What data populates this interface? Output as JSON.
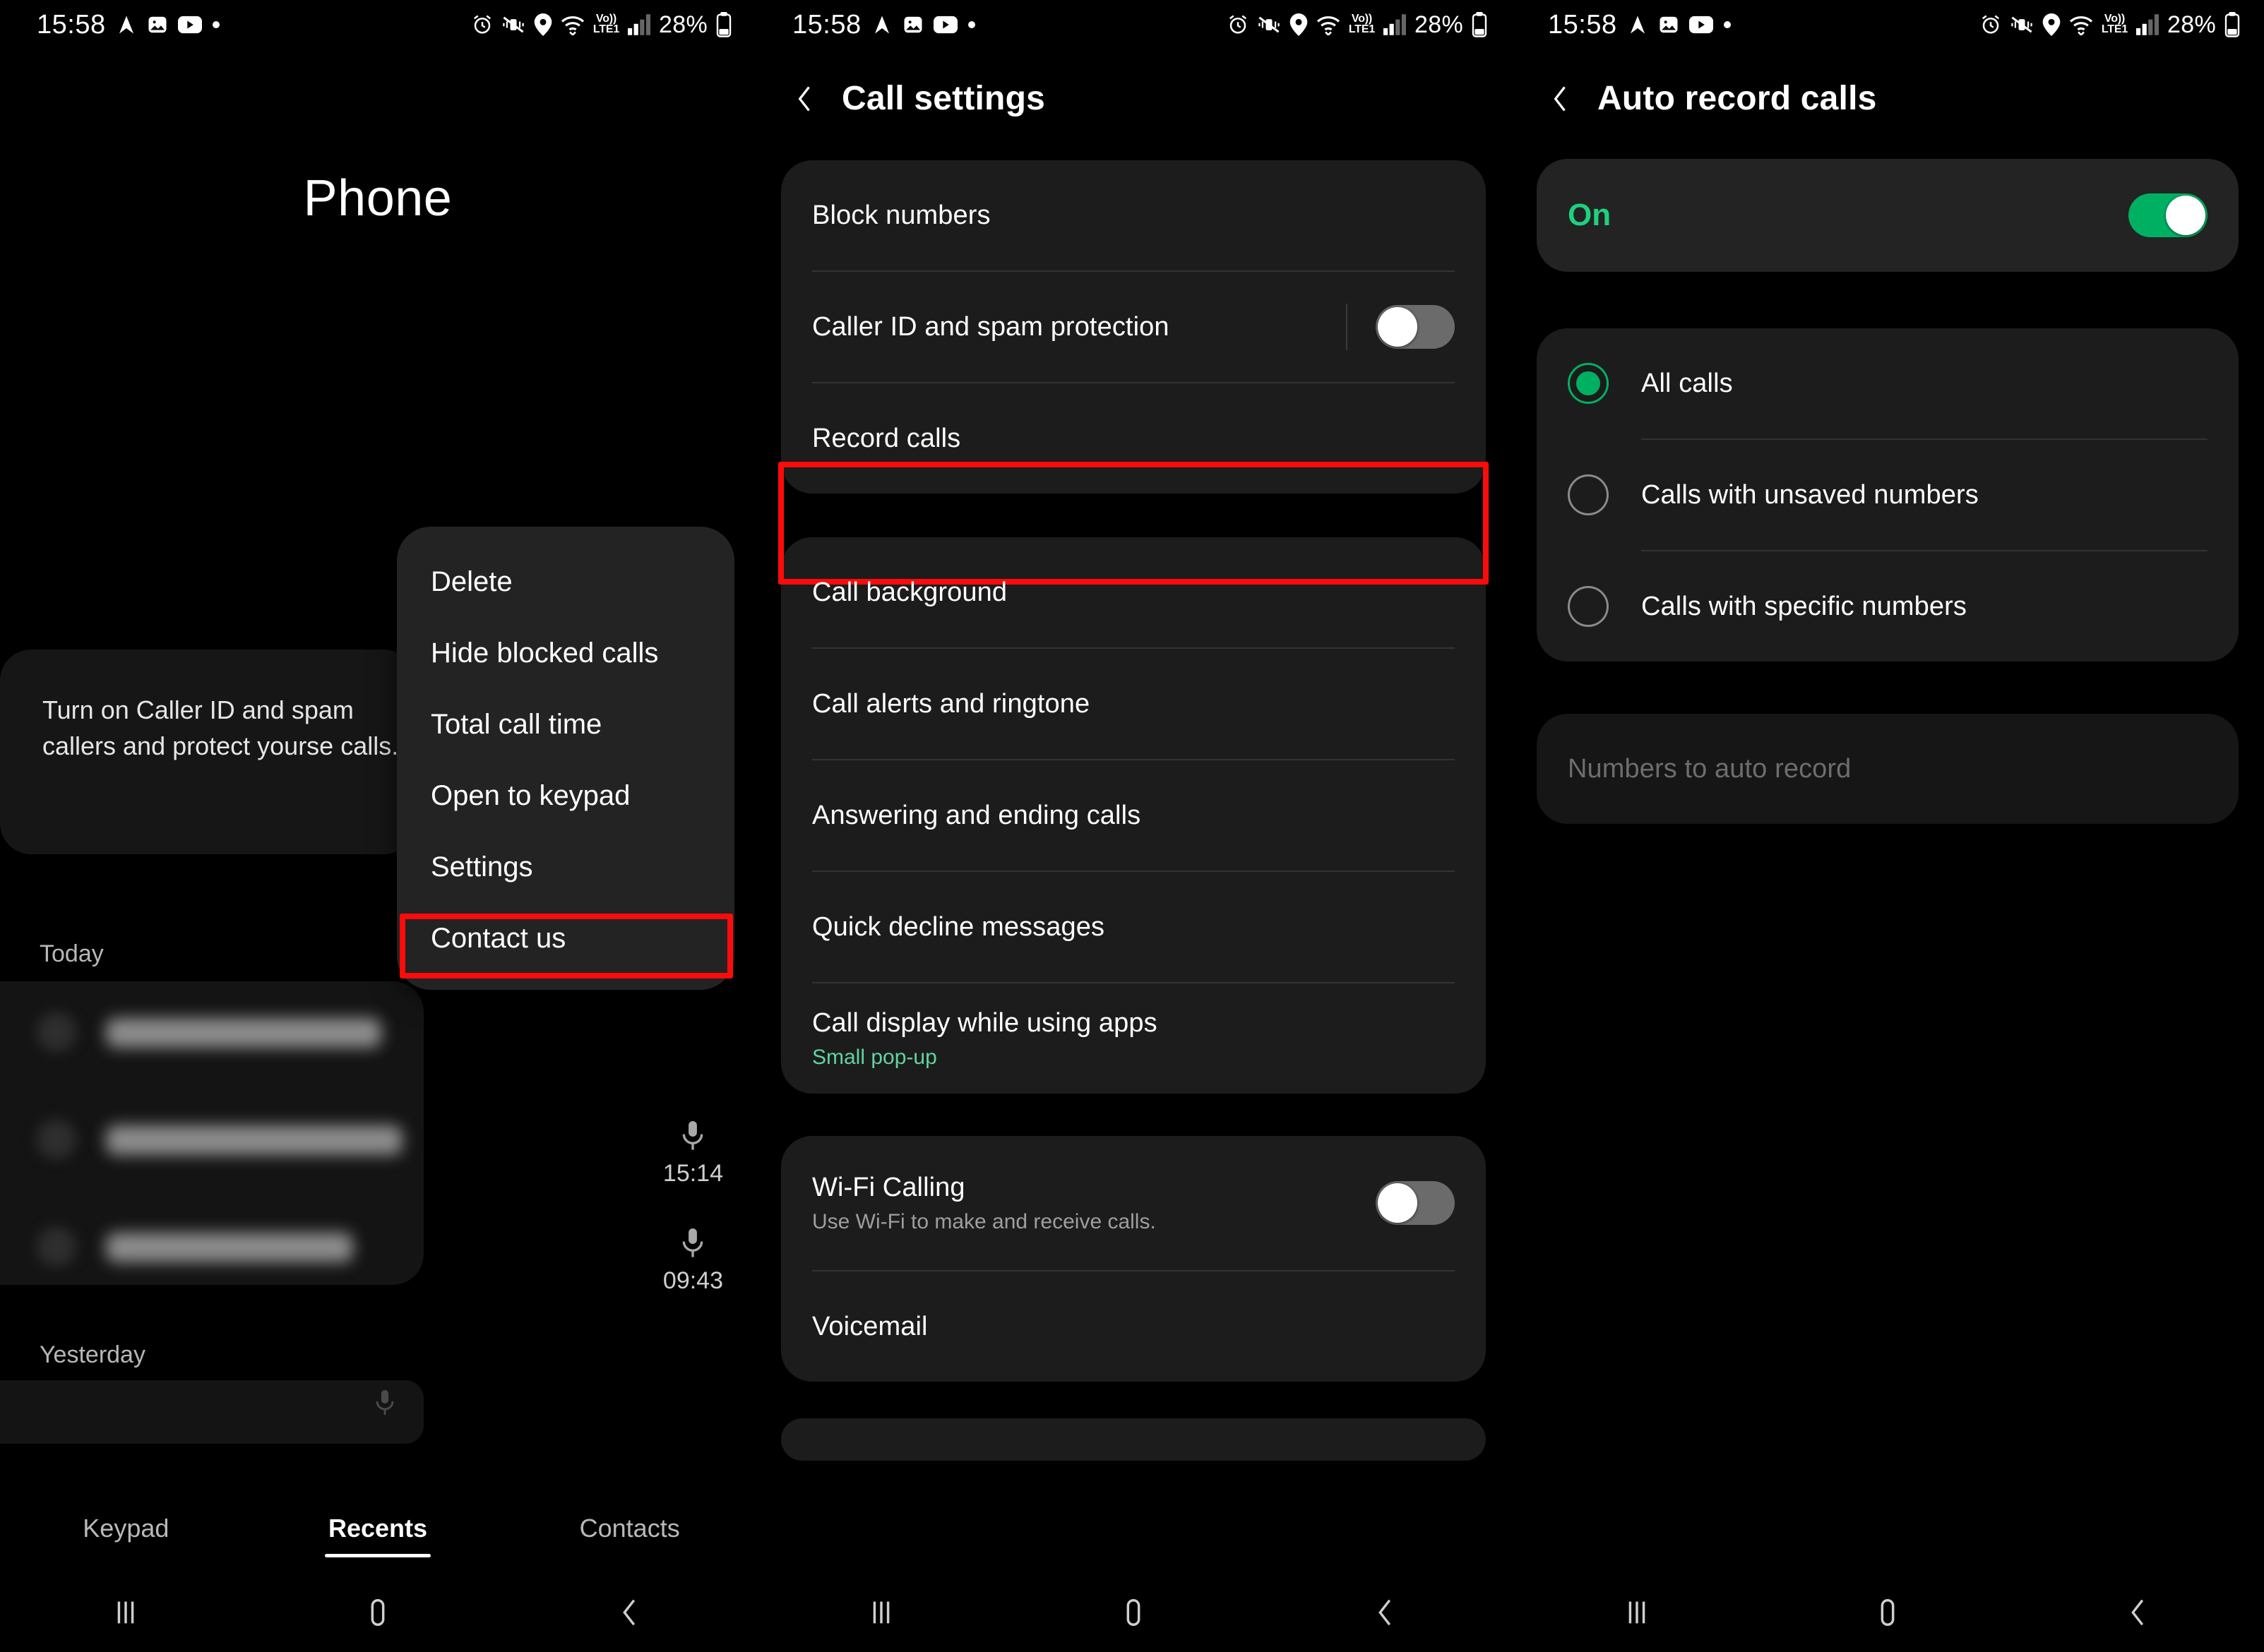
{
  "statusbar": {
    "time": "15:58",
    "battery": "28%",
    "network_label_top": "Vo)) ",
    "network_label": "LTE1",
    "left_icons": [
      "navigation-arrow-icon",
      "gallery-icon",
      "youtube-icon",
      "dot-icon"
    ],
    "right_icons": [
      "alarm-icon",
      "vibrate-off-icon",
      "location-icon",
      "wifi-icon",
      "volte-icon",
      "signal-bars-icon",
      "battery-icon"
    ]
  },
  "screen1": {
    "title": "Phone",
    "spam_card_text": "Turn on Caller ID and spam callers and protect yourse calls.",
    "section_today": "Today",
    "section_yesterday": "Yesterday",
    "calls": [
      {
        "time": "",
        "mic": true
      },
      {
        "time": "15:14",
        "mic": true
      },
      {
        "time": "09:43",
        "mic": true
      }
    ],
    "menu": {
      "items": [
        {
          "label": "Delete",
          "highlighted": false
        },
        {
          "label": "Hide blocked calls",
          "highlighted": false
        },
        {
          "label": "Total call time",
          "highlighted": false
        },
        {
          "label": "Open to keypad",
          "highlighted": false
        },
        {
          "label": "Settings",
          "highlighted": true
        },
        {
          "label": "Contact us",
          "highlighted": false
        }
      ]
    },
    "tabs": [
      {
        "label": "Keypad",
        "active": false
      },
      {
        "label": "Recents",
        "active": true
      },
      {
        "label": "Contacts",
        "active": false
      }
    ]
  },
  "screen2": {
    "title": "Call settings",
    "group1": [
      {
        "label": "Block numbers",
        "control": "none"
      },
      {
        "label": "Caller ID and spam protection",
        "control": "switch",
        "state": "off"
      },
      {
        "label": "Record calls",
        "control": "none",
        "highlighted": true
      }
    ],
    "group2": [
      {
        "label": "Call background"
      },
      {
        "label": "Call alerts and ringtone"
      },
      {
        "label": "Answering and ending calls"
      },
      {
        "label": "Quick decline messages"
      },
      {
        "label": "Call display while using apps",
        "sub": "Small pop-up"
      }
    ],
    "group3": [
      {
        "label": "Wi-Fi Calling",
        "sub": "Use Wi-Fi to make and receive calls.",
        "control": "switch",
        "state": "off"
      },
      {
        "label": "Voicemail",
        "control": "none"
      }
    ]
  },
  "screen3": {
    "title": "Auto record calls",
    "master": {
      "label": "On",
      "state": "on"
    },
    "options": [
      {
        "label": "All calls",
        "selected": true
      },
      {
        "label": "Calls with unsaved numbers",
        "selected": false
      },
      {
        "label": "Calls with specific numbers",
        "selected": false
      }
    ],
    "disabled_row": {
      "label": "Numbers to auto record"
    }
  },
  "navbar": {
    "recents": "recents-icon",
    "home": "home-icon",
    "back": "back-icon"
  },
  "colors": {
    "accent_green": "#00b062",
    "sub_green": "#63d2a0",
    "highlight_red": "#fd0b0b",
    "card_bg": "#1c1c1c"
  }
}
